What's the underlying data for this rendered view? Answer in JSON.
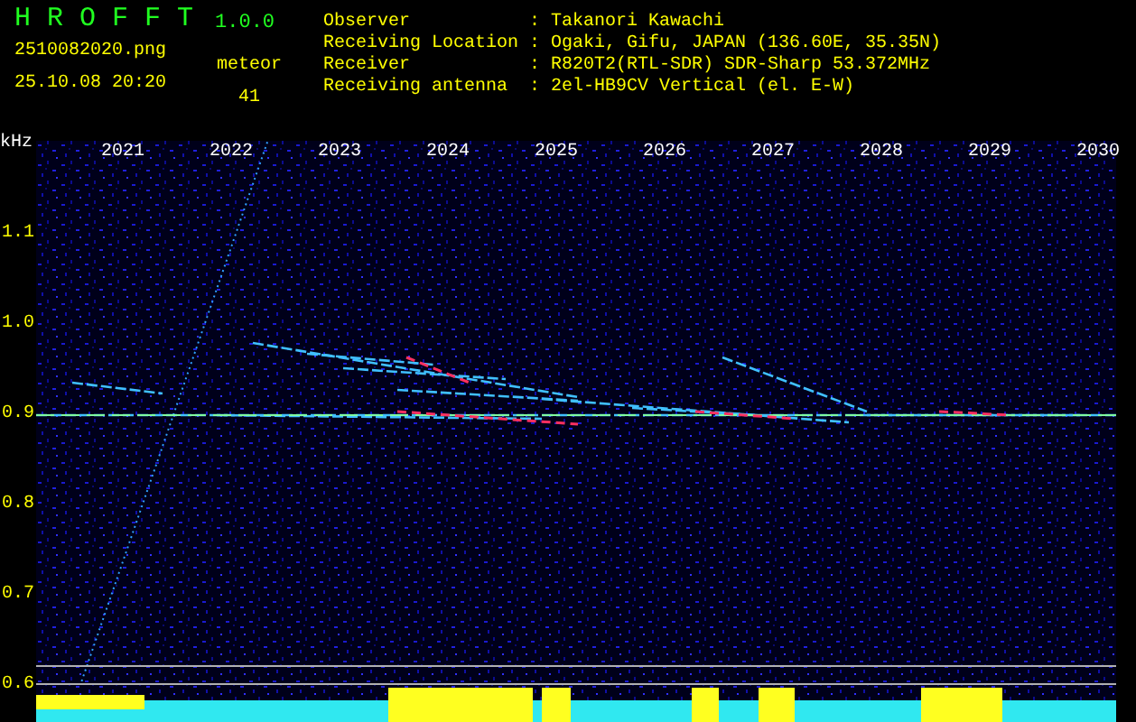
{
  "app": {
    "name": "H R O F F T",
    "version": "1.0.0"
  },
  "file": {
    "name": "2510082020.png",
    "timestamp": "25.10.08 20:20"
  },
  "meteor": {
    "label": "meteor",
    "count": "41"
  },
  "station": [
    {
      "label": "Observer",
      "value": ": Takanori Kawachi"
    },
    {
      "label": "Receiving Location",
      "value": ": Ogaki, Gifu, JAPAN (136.60E, 35.35N)"
    },
    {
      "label": "Receiver",
      "value": ": R820T2(RTL-SDR) SDR-Sharp 53.372MHz"
    },
    {
      "label": "Receiving antenna",
      "value": ": 2el-HB9CV Vertical (el. E-W)"
    }
  ],
  "spectrogram": {
    "y_unit": "kHz",
    "x_labels": [
      "2021",
      "2022",
      "2023",
      "2024",
      "2025",
      "2026",
      "2027",
      "2028",
      "2029",
      "2030"
    ],
    "y_labels": [
      "1.1",
      "1.0",
      "0.9",
      "0.8",
      "0.7",
      "0.6"
    ]
  }
}
